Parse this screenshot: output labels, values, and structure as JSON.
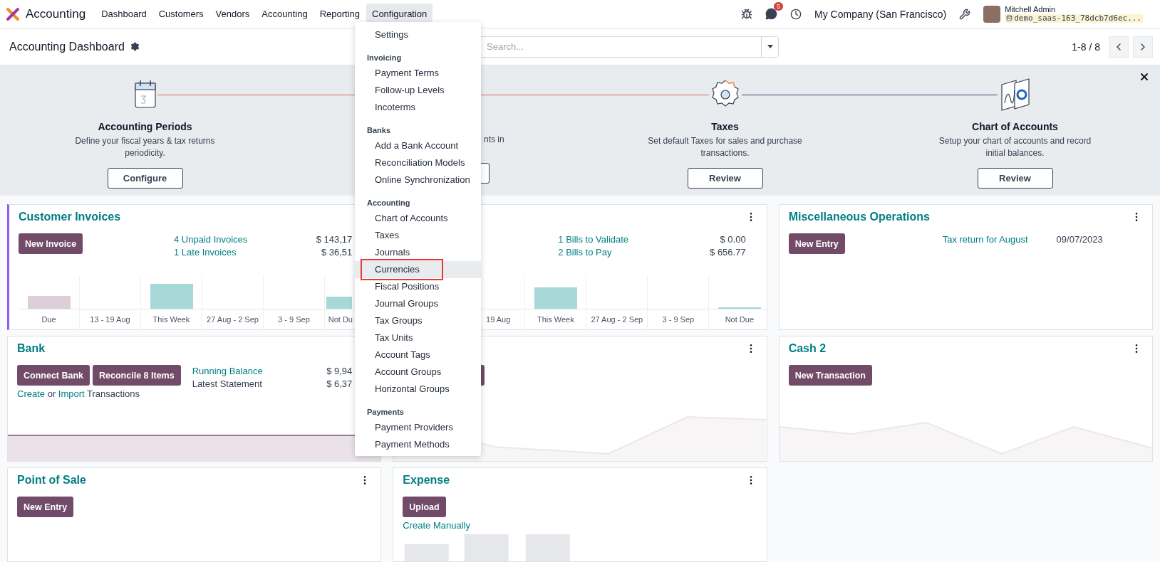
{
  "navbar": {
    "app_name": "Accounting",
    "menu": [
      {
        "label": "Dashboard",
        "selected": false
      },
      {
        "label": "Customers",
        "selected": false
      },
      {
        "label": "Vendors",
        "selected": false
      },
      {
        "label": "Accounting",
        "selected": false
      },
      {
        "label": "Reporting",
        "selected": false
      },
      {
        "label": "Configuration",
        "selected": true
      }
    ],
    "notification_count": "5",
    "company": "My Company (San Francisco)",
    "user_name": "Mitchell Admin",
    "database": "demo_saas-163_78dcb7d6ec..."
  },
  "control_panel": {
    "title": "Accounting Dashboard",
    "search": {
      "placeholder": "Search..."
    },
    "pager": "1-8 / 8"
  },
  "onboarding": {
    "steps": [
      {
        "kind": "full",
        "title": "Accounting Periods",
        "description": "Define your fiscal years & tax returns periodicity.",
        "button": "Configure"
      },
      {
        "kind": "covered",
        "description": "nts in"
      },
      {
        "kind": "full",
        "title": "Taxes",
        "description": "Set default Taxes for sales and purchase transactions.",
        "button": "Review"
      },
      {
        "kind": "full",
        "title": "Chart of Accounts",
        "description": "Setup your chart of accounts and record initial balances.",
        "button": "Review"
      }
    ]
  },
  "dropdown": {
    "items": [
      {
        "kind": "item",
        "label": "Settings",
        "selected": false
      },
      {
        "kind": "header",
        "label": "Invoicing"
      },
      {
        "kind": "item",
        "label": "Payment Terms",
        "selected": false
      },
      {
        "kind": "item",
        "label": "Follow-up Levels",
        "selected": false
      },
      {
        "kind": "item",
        "label": "Incoterms",
        "selected": false
      },
      {
        "kind": "header",
        "label": "Banks"
      },
      {
        "kind": "item",
        "label": "Add a Bank Account",
        "selected": false
      },
      {
        "kind": "item",
        "label": "Reconciliation Models",
        "selected": false
      },
      {
        "kind": "item",
        "label": "Online Synchronization",
        "selected": false
      },
      {
        "kind": "header",
        "label": "Accounting"
      },
      {
        "kind": "item",
        "label": "Chart of Accounts",
        "selected": false
      },
      {
        "kind": "item",
        "label": "Taxes",
        "selected": false
      },
      {
        "kind": "item",
        "label": "Journals",
        "selected": false
      },
      {
        "kind": "item",
        "label": "Currencies",
        "selected": true
      },
      {
        "kind": "item",
        "label": "Fiscal Positions",
        "selected": false
      },
      {
        "kind": "item",
        "label": "Journal Groups",
        "selected": false
      },
      {
        "kind": "item",
        "label": "Tax Groups",
        "selected": false
      },
      {
        "kind": "item",
        "label": "Tax Units",
        "selected": false
      },
      {
        "kind": "item",
        "label": "Account Tags",
        "selected": false
      },
      {
        "kind": "item",
        "label": "Account Groups",
        "selected": false
      },
      {
        "kind": "item",
        "label": "Horizontal Groups",
        "selected": false
      },
      {
        "kind": "header",
        "label": "Payments"
      },
      {
        "kind": "item",
        "label": "Payment Providers",
        "selected": false
      },
      {
        "kind": "item",
        "label": "Payment Methods",
        "selected": false
      }
    ]
  },
  "cards": [
    {
      "kind": "journal",
      "title": "Customer Invoices",
      "highlighted": true,
      "menu": false,
      "buttons": [
        {
          "kind": "button",
          "label": "New Invoice"
        }
      ],
      "stats": [
        {
          "label": "4 Unpaid Invoices",
          "link": true,
          "value": "$ 143,17"
        },
        {
          "label": "1 Late Invoices",
          "link": true,
          "value": "$ 36,51"
        }
      ],
      "chart": {
        "kind": "bars",
        "labels": [
          "Due",
          "13 - 19 Aug",
          "This Week",
          "27 Aug - 2 Sep",
          "3 - 9 Sep",
          "Not Du"
        ]
      }
    },
    {
      "kind": "journal",
      "highlighted": false,
      "menu": true,
      "stats": [
        {
          "label": "1 Bills to Validate",
          "link": true,
          "value": "$ 0.00"
        },
        {
          "label": "2 Bills to Pay",
          "link": true,
          "value": "$ 656.77"
        }
      ],
      "chart": {
        "kind": "bars-covered",
        "labels": [
          "19 Aug",
          "This Week",
          "27 Aug - 2 Sep",
          "3 - 9 Sep",
          "Not Due"
        ]
      }
    },
    {
      "kind": "misc",
      "title": "Miscellaneous Operations",
      "highlighted": false,
      "menu": true,
      "buttons": [
        {
          "kind": "button",
          "label": "New Entry"
        }
      ],
      "stats": [
        {
          "label": "Tax return for August",
          "link": true,
          "value": "09/07/2023"
        }
      ]
    },
    {
      "kind": "journal",
      "title": "Bank",
      "highlighted": false,
      "menu": false,
      "buttons": [
        {
          "kind": "button",
          "label": "Connect Bank"
        },
        {
          "kind": "button",
          "label": "Reconcile 8 Items"
        }
      ],
      "sentence": [
        {
          "text": "Create",
          "link": true
        },
        {
          "text": "or",
          "link": false
        },
        {
          "text": "Import",
          "link": true
        },
        {
          "text": "Transactions",
          "link": false
        }
      ],
      "stats": [
        {
          "label": "Running Balance",
          "link": true,
          "value": "$ 9,94"
        },
        {
          "label": "Latest Statement",
          "link": false,
          "value": "$ 6,37"
        }
      ],
      "chart": {
        "kind": "flat"
      }
    },
    {
      "kind": "journal",
      "highlighted": false,
      "menu": true,
      "buttons": [
        {
          "kind": "stub"
        }
      ],
      "chart": {
        "kind": "line-a"
      }
    },
    {
      "kind": "journal",
      "title": "Cash 2",
      "highlighted": false,
      "menu": true,
      "buttons": [
        {
          "kind": "button",
          "label": "New Transaction"
        }
      ],
      "chart": {
        "kind": "line-b"
      }
    },
    {
      "kind": "journal",
      "title": "Point of Sale",
      "highlighted": false,
      "menu": true,
      "buttons": [
        {
          "kind": "button",
          "label": "New Entry"
        }
      ]
    },
    {
      "kind": "journal",
      "title": "Expense",
      "highlighted": false,
      "menu": true,
      "buttons": [
        {
          "kind": "button",
          "label": "Upload"
        }
      ],
      "sentence": [
        {
          "text": "Create Manually",
          "link": true
        }
      ],
      "chart": {
        "kind": "grey-bars"
      }
    }
  ]
}
